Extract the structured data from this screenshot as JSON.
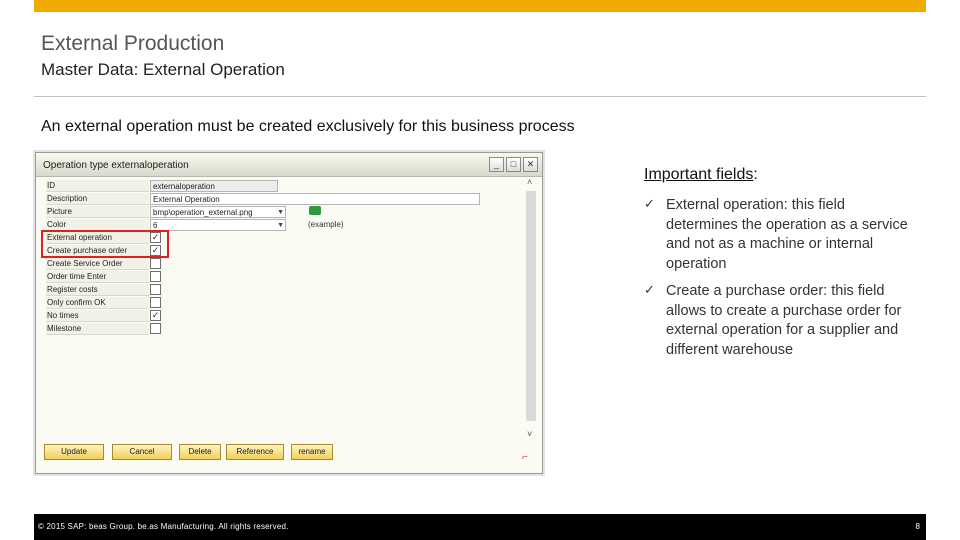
{
  "slide": {
    "title": "External Production",
    "subtitle": "Master Data: External Operation",
    "intro": "An external operation must be created exclusively for this business process"
  },
  "window": {
    "title": "Operation type externaloperation",
    "controls": {
      "minimize": "_",
      "maximize": "□",
      "close": "✕"
    },
    "fields": [
      {
        "label": "ID",
        "value": "externaloperation",
        "type": "text"
      },
      {
        "label": "Description",
        "value": "External Operation",
        "type": "text"
      },
      {
        "label": "Picture",
        "value": "bmp\\operation_external.png",
        "type": "dropdown"
      },
      {
        "label": "Color",
        "value": "6",
        "type": "dropdown"
      }
    ],
    "checkboxes": [
      {
        "label": "External operation",
        "checked": true
      },
      {
        "label": "Create purchase order",
        "checked": true
      },
      {
        "label": "Create Service Order",
        "checked": false
      },
      {
        "label": "Order time Enter",
        "checked": false
      },
      {
        "label": "Register costs",
        "checked": false
      },
      {
        "label": "Only confirm OK",
        "checked": false
      },
      {
        "label": "No times",
        "checked": true
      },
      {
        "label": "Milestone",
        "checked": false
      }
    ],
    "example_label": "(example)",
    "example_icon": "operation-picture-icon",
    "buttons": [
      "Update",
      "Cancel",
      "Delete",
      "Reference",
      "rename"
    ]
  },
  "important": {
    "title": "Important fields",
    "colon": ":",
    "bullets": [
      "External operation: this field determines the operation as a service and not as a machine or internal operation",
      "Create a purchase order: this field allows to create a purchase order for external operation for a supplier and different warehouse"
    ],
    "check_glyph": "✓"
  },
  "footer": {
    "copyright": "© 2015 SAP: beas Group. be.as Manufacturing.  All rights reserved.",
    "page": "8"
  },
  "colors": {
    "accent_bar": "#f0ab00",
    "highlight": "#e02020",
    "footer_bg": "#000000"
  }
}
